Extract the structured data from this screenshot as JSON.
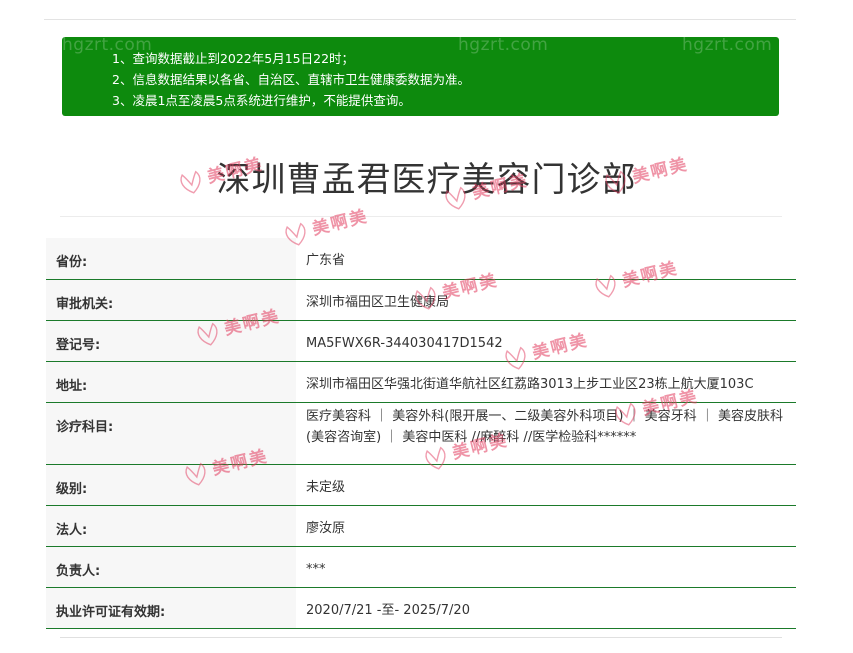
{
  "notice": {
    "watermarks": [
      "hgzrt.com",
      "hgzrt.com",
      "hgzrt.com"
    ],
    "lines": [
      "1、查询数据截止到2022年5月15日22时；",
      "2、信息数据结果以各省、自治区、直辖市卫生健康委数据为准。",
      "3、凌晨1点至凌晨5点系统进行维护，不能提供查询。"
    ],
    "bg_color": "#0d8a0d"
  },
  "title": "深圳曹孟君医疗美容门诊部",
  "watermark_text": "美啊美",
  "rows": [
    {
      "label": "省份:",
      "value": "广东省"
    },
    {
      "label": "审批机关:",
      "value": "深圳市福田区卫生健康局"
    },
    {
      "label": "登记号:",
      "value": "MA5FWX6R-344030417D1542"
    },
    {
      "label": "地址:",
      "value": "深圳市福田区华强北街道华航社区红荔路3013上步工业区23栋上航大厦103C"
    },
    {
      "label": "诊疗科目:",
      "value": "医疗美容科 ｜ 美容外科(限开展一、二级美容外科项目) ｜ 美容牙科 ｜ 美容皮肤科(美容咨询室) ｜ 美容中医科 //麻醉科 //医学检验科******"
    },
    {
      "label": "级别:",
      "value": "未定级"
    },
    {
      "label": "法人:",
      "value": "廖汝原"
    },
    {
      "label": "负责人:",
      "value": "***"
    },
    {
      "label": "执业许可证有效期:",
      "value": "2020/7/21 -至- 2025/7/20"
    }
  ],
  "colors": {
    "accent": "#0d8a0d",
    "row_border": "#1b7a2a",
    "watermark": "#e23c5f"
  }
}
